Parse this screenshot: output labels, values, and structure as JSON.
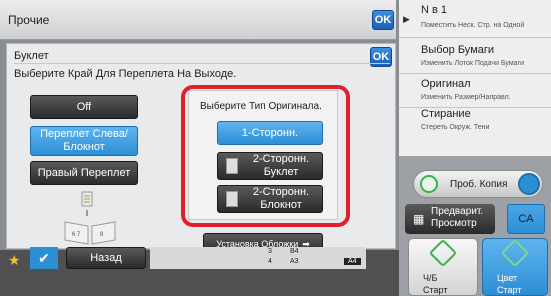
{
  "topbar": {
    "title": "Прочие",
    "ok": "OK"
  },
  "panel": {
    "title": "Буклет",
    "ok": "OK",
    "subtitle": "Выберите Край Для Переплета На Выходе."
  },
  "binding_options": [
    {
      "label": "Off",
      "selected": false
    },
    {
      "label": "Переплет Слева/ Блокнот",
      "selected": true
    },
    {
      "label": "Правый Переплет",
      "selected": false
    }
  ],
  "original_type": {
    "prompt": "Выберите Тип Оригинала.",
    "options": [
      {
        "label": "1-Сторонн.",
        "selected": true
      },
      {
        "label": "2-Сторонн. Буклет",
        "selected": false
      },
      {
        "label": "2-Сторонн. Блокнот",
        "selected": false
      }
    ]
  },
  "cover_button": "Установка Обложки",
  "sidebar": {
    "items": [
      {
        "heading": "N в 1",
        "sub": "Поместить Неск. Стр. на Одной"
      },
      {
        "heading": "Выбор Бумаги",
        "sub": "Изменить Лоток Подачи Бумаги"
      },
      {
        "heading": "Оригинал",
        "sub": "Изменить Размер/Направл."
      },
      {
        "heading": "Стирание",
        "sub": "Стереть Окруж. Тени"
      }
    ],
    "proof_copy": "Проб. Копия",
    "preview": "Предварит. Просмотр",
    "ca": "CA",
    "bw_start_1": "Ч/Б",
    "bw_start_2": "Старт",
    "color_start_1": "Цвет",
    "color_start_2": "Старт"
  },
  "bottom": {
    "back": "Назад",
    "tray_rows": [
      {
        "num": "3",
        "size": "B4"
      },
      {
        "num": "4",
        "size": "A3"
      }
    ],
    "paper_size": "A4"
  },
  "colors": {
    "accent_blue": "#2c8fd6",
    "highlight_red": "#e0202c",
    "start_green": "#38b24a"
  }
}
